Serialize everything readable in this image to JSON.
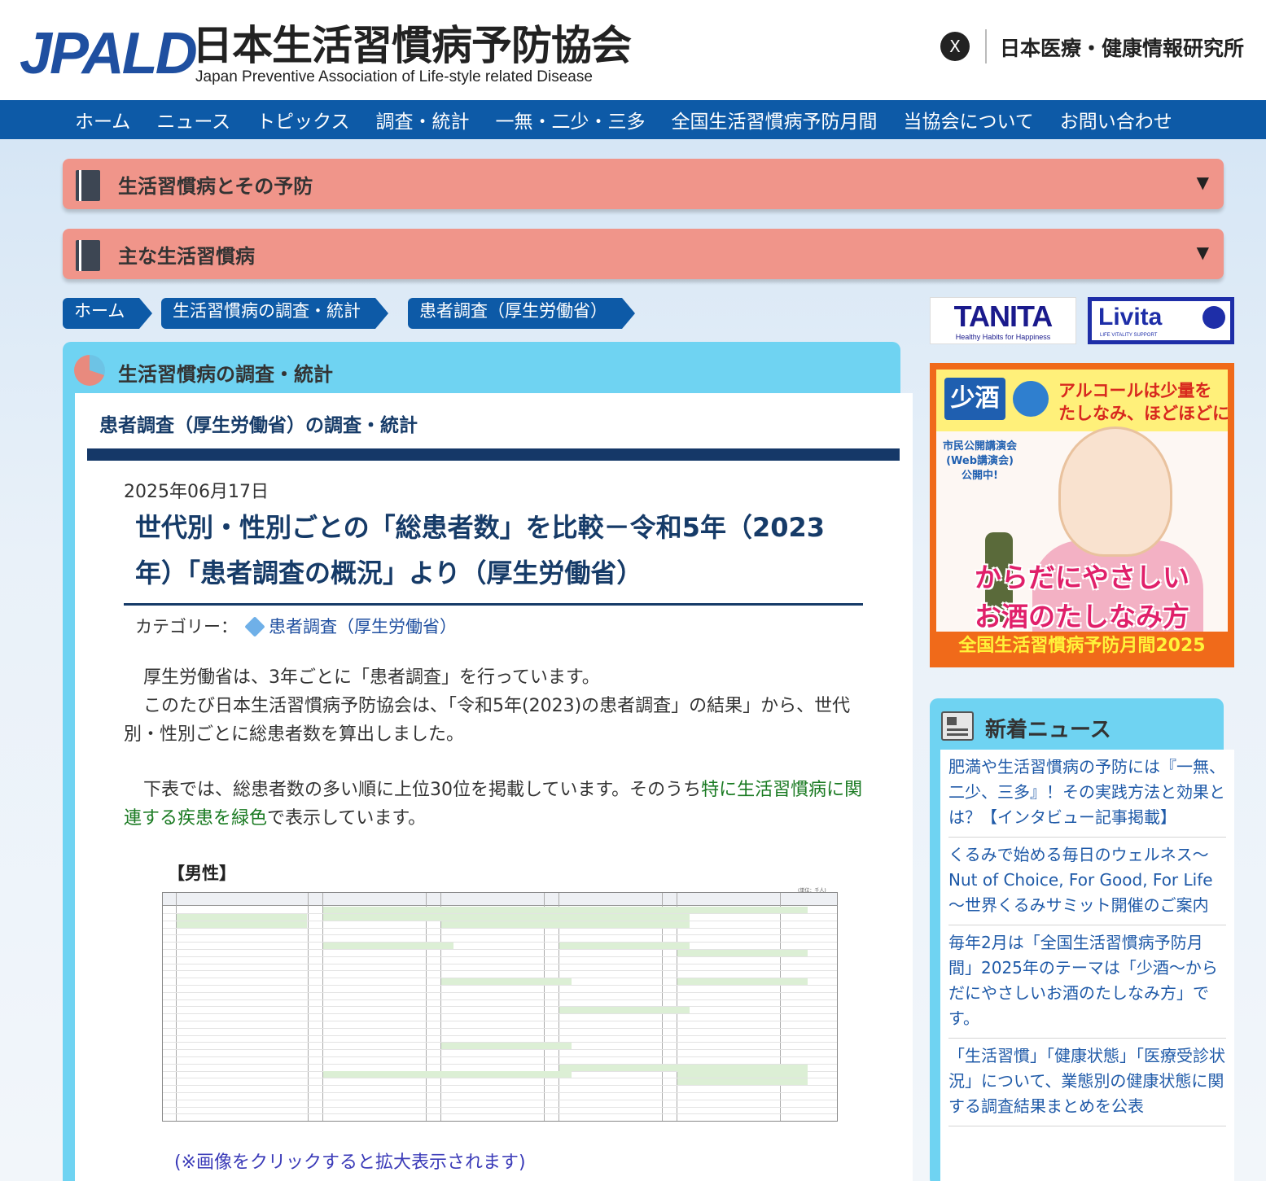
{
  "header": {
    "logo_mark": "JPALD",
    "logo_jp": "日本生活習慣病予防協会",
    "logo_en": "Japan Preventive Association of Life-style related Disease",
    "x_icon": "X",
    "partner_text": "日本医療・健康情報研究所"
  },
  "nav": [
    "ホーム",
    "ニュース",
    "トピックス",
    "調査・統計",
    "一無・二少・三多",
    "全国生活習慣病予防月間",
    "当協会について",
    "お問い合わせ"
  ],
  "accordions": [
    {
      "label": "生活習慣病とその予防",
      "arrow": "▼"
    },
    {
      "label": "主な生活習慣病",
      "arrow": "▼"
    }
  ],
  "breadcrumb": [
    "ホーム",
    "生活習慣病の調査・統計",
    "患者調査（厚生労働省）"
  ],
  "panel": {
    "title": "生活習慣病の調査・統計",
    "card_heading": "患者調査（厚生労働省）の調査・統計"
  },
  "article": {
    "date": "2025年06月17日",
    "title": "世代別・性別ごとの「総患者数」を比較－令和5年（2023年）「患者調査の概況」より（厚生労働省）",
    "category_label": "カテゴリー：",
    "category": "患者調査（厚生労働省）",
    "p1": "厚生労働省は、3年ごとに「患者調査」を行っています。",
    "p2": "このたび日本生活習慣病予防協会は、「令和5年(2023)の患者調査」の結果」から、世代別・性別ごとに総患者数を算出しました。",
    "p3a": "下表では、総患者数の多い順に上位30位を掲載しています。そのうち",
    "p3b": "特に生活習慣病に関連する疾患を緑色",
    "p3c": "で表示しています。",
    "table_caption": "【男性】",
    "table_unit": "(単位：千人)",
    "note": "(※画像をクリックすると拡大表示されます)"
  },
  "sidebar": {
    "tanita": "TANITA",
    "tanita_tag": "Healthy Habits for Happiness",
    "livita": "Livita",
    "livita_tag": "LIFE VITALITY SUPPORT",
    "banner": {
      "badge": "少酒",
      "headline1": "アルコールは少量を",
      "headline2": "たしなみ、ほどほどに!",
      "sub1": "市民公開講演会",
      "sub2": "(Web講演会)",
      "sub3": "公開中!",
      "main1": "からだにやさしい",
      "main2": "お酒のたしなみ方",
      "footer": "全国生活習慣病予防月間2025"
    },
    "news_title": "新着ニュース",
    "news": [
      "肥満や生活習慣病の予防には『一無、二少、三多』！その実践方法と効果とは？【インタビュー記事掲載】",
      "くるみで始める毎日のウェルネス～Nut of Choice, For Good, For Life～世界くるみサミット開催のご案内",
      "毎年2月は「全国生活習慣病予防月間」2025年のテーマは「少酒～からだにやさしいお酒のたしなみ方」です。",
      "「生活習慣」「健康状態」「医療受診状況」について、業態別の健康状態に関する調査結果まとめを公表"
    ]
  },
  "colors": {
    "nav": "#0d5aa7",
    "accordion": "#f0958a",
    "panel": "#6fd3f2",
    "title": "#163b68",
    "green": "#1a7a22"
  }
}
